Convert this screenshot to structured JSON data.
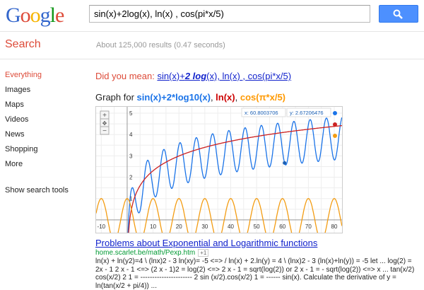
{
  "logo": {
    "letters": [
      {
        "ch": "G",
        "color": "#3366cc"
      },
      {
        "ch": "o",
        "color": "#dd4b39"
      },
      {
        "ch": "o",
        "color": "#f6b400"
      },
      {
        "ch": "g",
        "color": "#3366cc"
      },
      {
        "ch": "l",
        "color": "#109618"
      },
      {
        "ch": "e",
        "color": "#dd4b39"
      }
    ]
  },
  "search": {
    "query": "sin(x)+2log(x), ln(x) , cos(pi*x/5)"
  },
  "subbar": {
    "title": "Search",
    "stats": "About 125,000 results (0.47 seconds)"
  },
  "nav": {
    "items": [
      "Everything",
      "Images",
      "Maps",
      "Videos",
      "News",
      "Shopping",
      "More"
    ],
    "active": "Everything",
    "tools": "Show search tools"
  },
  "didyoumean": {
    "prefix": "Did you mean: ",
    "link_a": "sin(x)+",
    "link_b": "2 log",
    "link_c": "(x), ln(x) , cos(pi*x/5)"
  },
  "graphfor": {
    "prefix": "Graph for ",
    "f1": "sin(x)+2*log10(x)",
    "sep1": ", ",
    "f2": "ln(x)",
    "sep2": ", ",
    "f3": "cos(π*x/5)"
  },
  "graph_readout": {
    "x": "x: 60.8003706",
    "y": "y: 2.67206476"
  },
  "chart_data": {
    "type": "line",
    "xlim": [
      -12,
      83
    ],
    "ylim": [
      -0.6,
      5.3
    ],
    "x_ticks": [
      -10,
      10,
      20,
      30,
      40,
      50,
      60,
      70,
      80
    ],
    "y_ticks": [
      1,
      2,
      3,
      4,
      5
    ],
    "grid": true,
    "legend": "top-right",
    "cursor_point": [
      60.8,
      2.67
    ],
    "series": [
      {
        "formula": "sin(x)+2*log10(x)",
        "color": "#1a73e8"
      },
      {
        "formula": "ln(x)",
        "color": "#cc2222"
      },
      {
        "formula": "cos(π*x/5)",
        "color": "#f39c12"
      }
    ]
  },
  "result": {
    "title": "Problems about Exponential and Logarithmic functions",
    "url": "home.scarlet.be/math/Pexp.htm",
    "plus": "+1",
    "snippet": "ln(x) + ln(y2)=4 \\ (lnx)2 - 3 ln(xy)= -5 <=> / ln(x) + 2.ln(y) = 4 \\ (lnx)2 - 3 (ln(x)+ln(y)) = -5 let ... log(2) = 2x - 1 2 x - 1 <=> (2 x - 1)2 = log(2) <=> 2 x - 1 = sqrt(log(2)) or 2 x - 1 = - sqrt(log(2)) <=> x ... tan(x/2) cos(x/2) 2 1 = ---------------------- 2 sin (x/2).cos(x/2) 1 = ------ sin(x). Calculate the derivative of y = ln(tan(x/2 + pi/4)) ..."
  }
}
